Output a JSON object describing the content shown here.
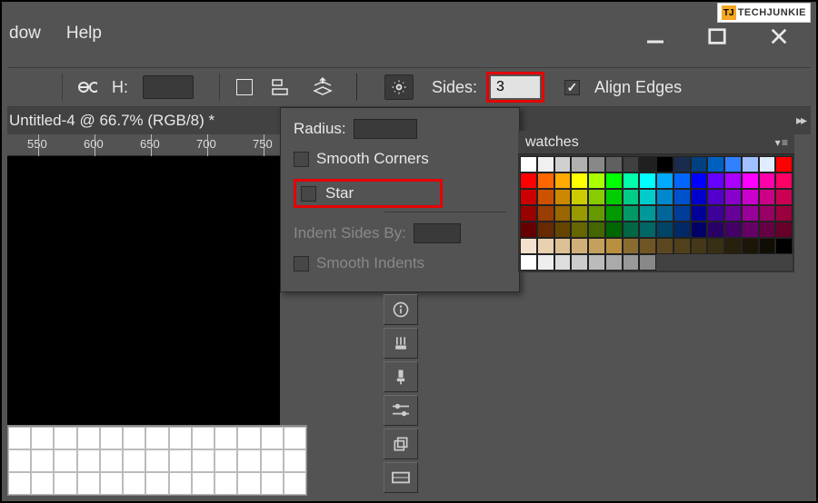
{
  "logo": {
    "icon_text": "TJ",
    "brand": "TECHJUNKIE"
  },
  "menubar": {
    "window": "dow",
    "help": "Help"
  },
  "options": {
    "h_label": "H:",
    "sides_label": "Sides:",
    "sides_value": "3",
    "align_edges_label": "Align Edges",
    "align_edges_checked": true
  },
  "dropdown": {
    "radius_label": "Radius:",
    "smooth_corners": "Smooth Corners",
    "star": "Star",
    "indent_label": "Indent Sides By:",
    "smooth_indents": "Smooth Indents"
  },
  "tab": {
    "title": "Untitled-4 @ 66.7% (RGB/8) *"
  },
  "ruler": {
    "marks": [
      "550",
      "600",
      "650",
      "700",
      "750"
    ]
  },
  "swatches": {
    "title": "watches",
    "colors": [
      "#ffffff",
      "#f0f0f0",
      "#d0d0d0",
      "#b0b0b0",
      "#888888",
      "#606060",
      "#404040",
      "#202020",
      "#000000",
      "#1a2b4d",
      "#004080",
      "#0060c0",
      "#3080ff",
      "#a0c0ff",
      "#e0ecff",
      "#ff0000",
      "#ff0000",
      "#ff6600",
      "#ffaa00",
      "#ffff00",
      "#aaff00",
      "#00ff00",
      "#00ffaa",
      "#00ffff",
      "#00aaff",
      "#0066ff",
      "#0000ff",
      "#6600ff",
      "#aa00ff",
      "#ff00ff",
      "#ff00aa",
      "#ff0066",
      "#cc0000",
      "#cc5200",
      "#cc8800",
      "#cccc00",
      "#88cc00",
      "#00cc00",
      "#00cc88",
      "#00cccc",
      "#0088cc",
      "#0052cc",
      "#0000cc",
      "#5200cc",
      "#8800cc",
      "#cc00cc",
      "#cc0088",
      "#cc0052",
      "#990000",
      "#993d00",
      "#996600",
      "#999900",
      "#669900",
      "#009900",
      "#009966",
      "#009999",
      "#006699",
      "#003d99",
      "#000099",
      "#3d0099",
      "#660099",
      "#990099",
      "#990066",
      "#99003d",
      "#660000",
      "#662900",
      "#664400",
      "#666600",
      "#446600",
      "#006600",
      "#006644",
      "#006666",
      "#004466",
      "#002966",
      "#000066",
      "#290066",
      "#440066",
      "#660066",
      "#660044",
      "#660029",
      "#f4e0cc",
      "#e8d0b0",
      "#dcc094",
      "#d0b078",
      "#c4a05c",
      "#b89040",
      "#8a6c30",
      "#705624",
      "#5c4820",
      "#50401c",
      "#443818",
      "#383014",
      "#281f0c",
      "#1c1608",
      "#100d04",
      "#000000",
      "#ffffff",
      "#eeeeee",
      "#dddddd",
      "#cccccc",
      "#bbbbbb",
      "#aaaaaa",
      "#999999",
      "#888888",
      "",
      "",
      "",
      "",
      "",
      "",
      "",
      ""
    ]
  }
}
